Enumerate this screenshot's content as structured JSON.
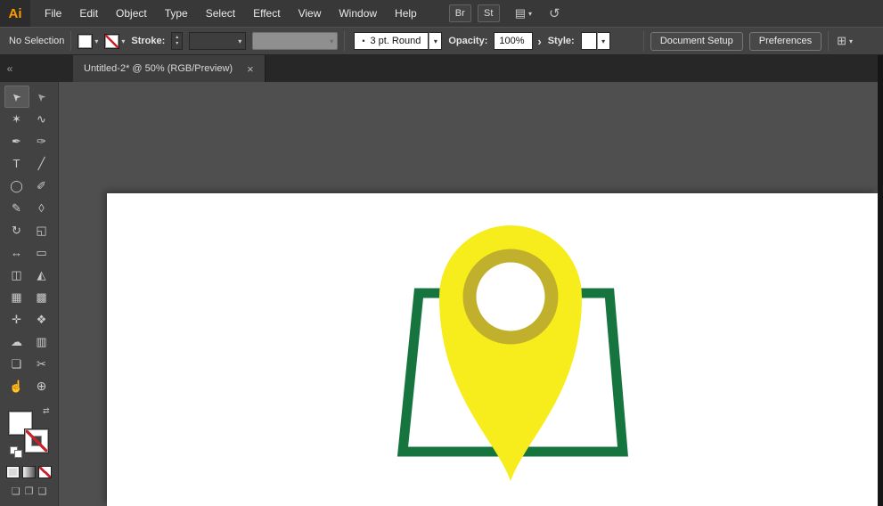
{
  "app": {
    "logo_text": "Ai",
    "logo_color": "#ff9a00"
  },
  "menubar": {
    "items": [
      "File",
      "Edit",
      "Object",
      "Type",
      "Select",
      "Effect",
      "View",
      "Window",
      "Help"
    ],
    "bridge_label": "Br",
    "stock_label": "St"
  },
  "controlbar": {
    "selection_status": "No Selection",
    "stroke_label": "Stroke:",
    "brush_value": "3 pt. Round",
    "opacity_label": "Opacity:",
    "opacity_value": "100%",
    "style_label": "Style:",
    "document_setup_label": "Document Setup",
    "preferences_label": "Preferences"
  },
  "tabbar": {
    "title": "Untitled-2* @ 50% (RGB/Preview)",
    "close_label": "×"
  },
  "toolbar": {
    "tools": [
      {
        "name": "selection-tool",
        "glyph": "➤",
        "selected": true
      },
      {
        "name": "direct-selection-tool",
        "glyph": "➤"
      },
      {
        "name": "magic-wand-tool",
        "glyph": "✶"
      },
      {
        "name": "lasso-tool",
        "glyph": "∿"
      },
      {
        "name": "pen-tool",
        "glyph": "✒"
      },
      {
        "name": "curvature-tool",
        "glyph": "✑"
      },
      {
        "name": "type-tool",
        "glyph": "T"
      },
      {
        "name": "line-segment-tool",
        "glyph": "╱"
      },
      {
        "name": "ellipse-tool",
        "glyph": "◯"
      },
      {
        "name": "paintbrush-tool",
        "glyph": "✐"
      },
      {
        "name": "pencil-tool",
        "glyph": "✎"
      },
      {
        "name": "eraser-tool",
        "glyph": "◊"
      },
      {
        "name": "rotate-tool",
        "glyph": "↻"
      },
      {
        "name": "scale-tool",
        "glyph": "◱"
      },
      {
        "name": "width-tool",
        "glyph": "↔"
      },
      {
        "name": "free-transform-tool",
        "glyph": "▭"
      },
      {
        "name": "shape-builder-tool",
        "glyph": "◫"
      },
      {
        "name": "perspective-grid-tool",
        "glyph": "◭"
      },
      {
        "name": "mesh-tool",
        "glyph": "▦"
      },
      {
        "name": "gradient-tool",
        "glyph": "▩"
      },
      {
        "name": "eyedropper-tool",
        "glyph": "✛"
      },
      {
        "name": "blend-tool",
        "glyph": "❖"
      },
      {
        "name": "symbol-sprayer-tool",
        "glyph": "☁"
      },
      {
        "name": "column-graph-tool",
        "glyph": "▥"
      },
      {
        "name": "artboard-tool",
        "glyph": "❏"
      },
      {
        "name": "slice-tool",
        "glyph": "✂"
      },
      {
        "name": "hand-tool",
        "glyph": "☝"
      },
      {
        "name": "zoom-tool",
        "glyph": "⊕"
      }
    ]
  },
  "icons": {
    "chevron_down": "▾",
    "chevron_right": "›",
    "spinner_up": "▴",
    "spinner_down": "▾",
    "workspace": "▤",
    "touch": "↺",
    "collapse": "«",
    "swap": "⇄",
    "arrange": "⊞",
    "brush_dot": "•",
    "draw_normal": "❏",
    "draw_behind": "❐",
    "draw_inside": "❑"
  },
  "artwork": {
    "map_stroke": "#16753f",
    "pin_fill": "#f7ec1c",
    "ring_stroke": "#c1b02c",
    "ring_fill": "#ffffff"
  },
  "colors": {
    "canvas_bg": "#4f4f4f",
    "artboard_bg": "#ffffff",
    "bar_bg": "#434343",
    "menu_bg": "#383838"
  }
}
